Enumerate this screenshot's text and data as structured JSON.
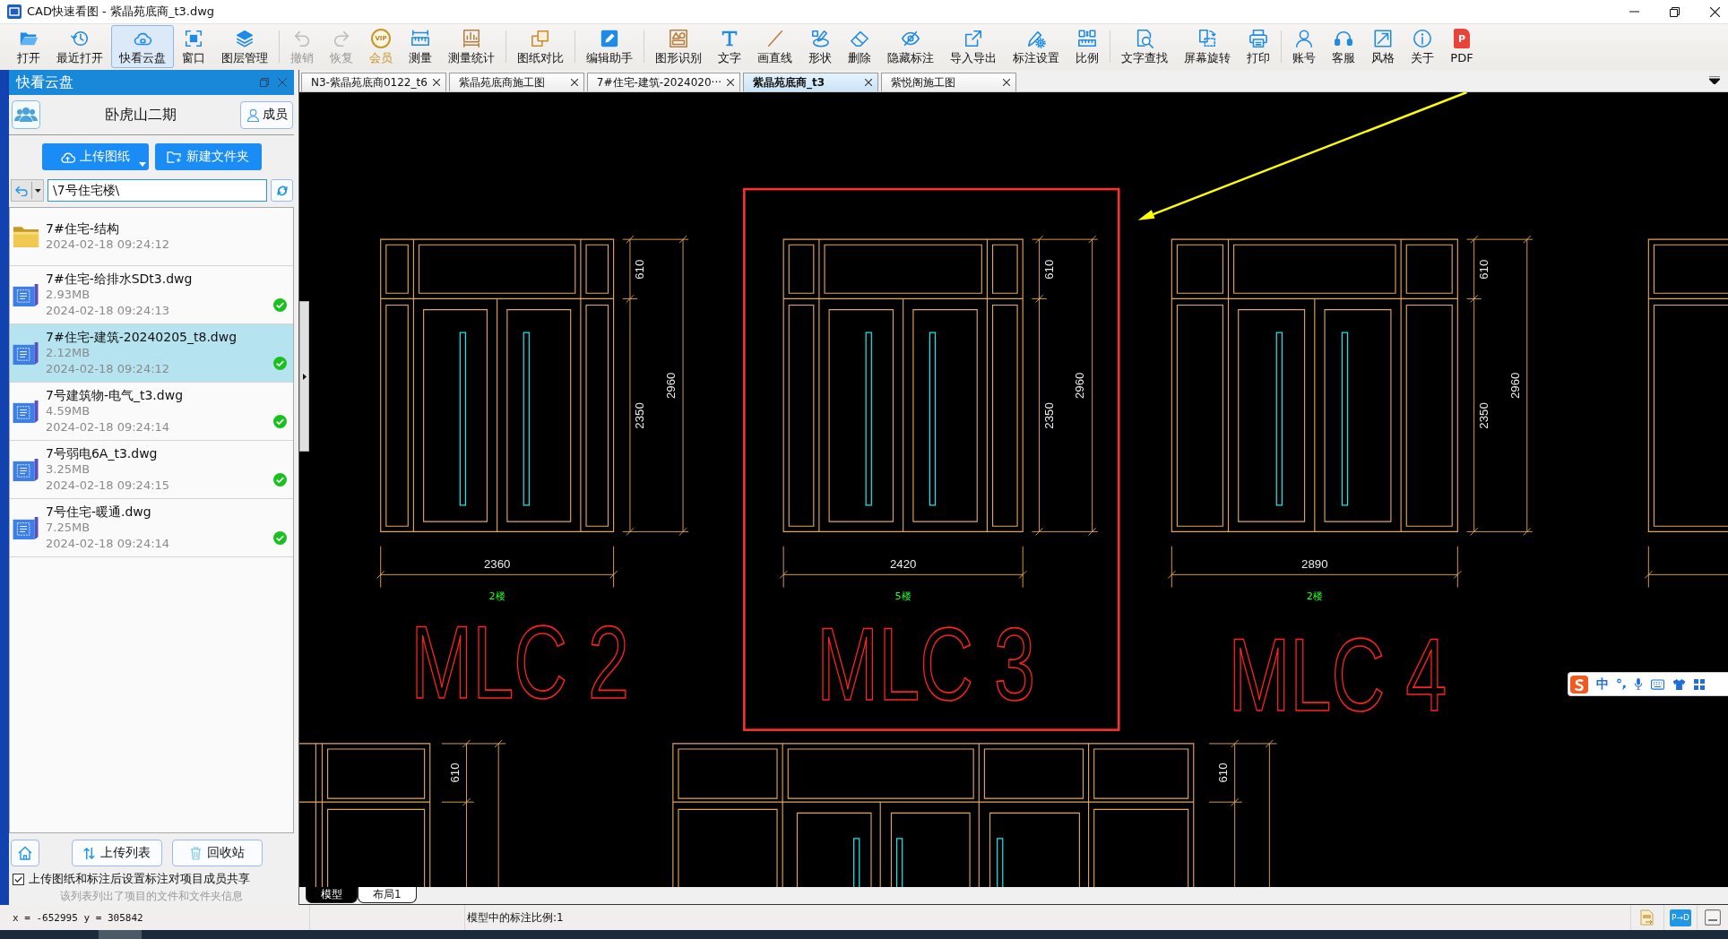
{
  "window": {
    "title": "CAD快速看图 - 紫晶苑底商_t3.dwg"
  },
  "toolbar": {
    "groups": [
      [
        {
          "label": "打开",
          "selected": false,
          "disabled": false
        },
        {
          "label": "最近打开",
          "selected": false,
          "disabled": false
        },
        {
          "label": "快看云盘",
          "selected": true,
          "disabled": false
        },
        {
          "label": "窗口",
          "selected": false,
          "disabled": false
        },
        {
          "label": "图层管理",
          "selected": false,
          "disabled": false
        }
      ],
      [
        {
          "label": "撤销",
          "selected": false,
          "disabled": true
        },
        {
          "label": "恢复",
          "selected": false,
          "disabled": true
        },
        {
          "label": "会员",
          "badge": "VIP",
          "selected": false,
          "disabled": false
        },
        {
          "label": "测量",
          "selected": false,
          "disabled": false
        },
        {
          "label": "测量统计",
          "selected": false,
          "disabled": false
        }
      ],
      [
        {
          "label": "图纸对比",
          "selected": false,
          "disabled": false
        }
      ],
      [
        {
          "label": "编辑助手",
          "selected": false,
          "disabled": false
        }
      ],
      [
        {
          "label": "图形识别",
          "selected": false,
          "disabled": false
        },
        {
          "label": "文字",
          "selected": false,
          "disabled": false
        },
        {
          "label": "画直线",
          "selected": false,
          "disabled": false
        },
        {
          "label": "形状",
          "selected": false,
          "disabled": false
        },
        {
          "label": "删除",
          "selected": false,
          "disabled": false
        },
        {
          "label": "隐藏标注",
          "selected": false,
          "disabled": false
        },
        {
          "label": "导入导出",
          "selected": false,
          "disabled": false
        },
        {
          "label": "标注设置",
          "selected": false,
          "disabled": false
        },
        {
          "label": "比例",
          "selected": false,
          "disabled": false
        }
      ],
      [
        {
          "label": "文字查找",
          "selected": false,
          "disabled": false
        },
        {
          "label": "屏幕旋转",
          "selected": false,
          "disabled": false
        },
        {
          "label": "打印",
          "selected": false,
          "disabled": false
        }
      ],
      [
        {
          "label": "账号",
          "selected": false,
          "disabled": false
        },
        {
          "label": "客服",
          "selected": false,
          "disabled": false
        },
        {
          "label": "风格",
          "selected": false,
          "disabled": false
        },
        {
          "label": "关于",
          "selected": false,
          "disabled": false
        },
        {
          "label": "PDF",
          "badge": "P",
          "selected": false,
          "disabled": false
        }
      ]
    ]
  },
  "tabs": [
    {
      "label": "N3-紫晶苑底商0122_t6",
      "selected": false
    },
    {
      "label": "紫晶苑底商施工图",
      "selected": false
    },
    {
      "label": "7#住宅-建筑-2024020···",
      "selected": false
    },
    {
      "label": "紫晶苑底商_t3",
      "selected": true
    },
    {
      "label": "紫悦阁施工图",
      "selected": false
    }
  ],
  "panel": {
    "title": "快看云盘",
    "project": "卧虎山二期",
    "members_button": "成员",
    "upload_button": "上传图纸",
    "new_folder_button": "新建文件夹",
    "path": "\\7号住宅楼\\",
    "files": [
      {
        "kind": "folder",
        "name": "7#住宅-结构",
        "date": "2024-02-18 09:24:12",
        "selected": false,
        "synced": false
      },
      {
        "kind": "file",
        "name": "7#住宅-给排水SDt3.dwg",
        "size": "2.93MB",
        "date": "2024-02-18 09:24:13",
        "selected": false,
        "synced": true
      },
      {
        "kind": "file",
        "name": "7#住宅-建筑-20240205_t8.dwg",
        "size": "2.12MB",
        "date": "2024-02-18 09:24:12",
        "selected": true,
        "synced": true
      },
      {
        "kind": "file",
        "name": "7号建筑物-电气_t3.dwg",
        "size": "4.59MB",
        "date": "2024-02-18 09:24:14",
        "selected": false,
        "synced": true
      },
      {
        "kind": "file",
        "name": "7号弱电6A_t3.dwg",
        "size": "3.25MB",
        "date": "2024-02-18 09:24:15",
        "selected": false,
        "synced": true
      },
      {
        "kind": "file",
        "name": "7号住宅-暖通.dwg",
        "size": "7.25MB",
        "date": "2024-02-18 09:24:14",
        "selected": false,
        "synced": true
      }
    ],
    "upload_list_button": "上传列表",
    "recycle_button": "回收站",
    "share_option": {
      "label": "上传图纸和标注后设置标注对项目成员共享",
      "checked": true
    },
    "info": "该列表列出了项目的文件和文件夹信息"
  },
  "drawing": {
    "elevations": [
      {
        "tag": "MLC 2",
        "floor": "2楼",
        "width_dim": "2360",
        "upper_dim": "610",
        "lower_dim": "2350",
        "total_dim": "2960",
        "highlighted": false
      },
      {
        "tag": "MLC 3",
        "floor": "5楼",
        "width_dim": "2420",
        "upper_dim": "610",
        "lower_dim": "2350",
        "total_dim": "2960",
        "highlighted": true
      },
      {
        "tag": "MLC 4",
        "floor": "2楼",
        "width_dim": "2890",
        "upper_dim": "610",
        "lower_dim": "2350",
        "total_dim": "2960",
        "highlighted": false
      }
    ],
    "lower_elevations": [
      {
        "upper_dim": "610"
      },
      {
        "upper_dim": "610"
      }
    ]
  },
  "layout_tabs": [
    {
      "label": "模型",
      "selected": true
    },
    {
      "label": "布局1",
      "selected": false
    }
  ],
  "ime": {
    "mode": "中"
  },
  "status_bar": {
    "coordinates": "x = -652995 y = 305842",
    "annotation_scale": "模型中的标注比例:1",
    "convert_button": "P→D"
  }
}
